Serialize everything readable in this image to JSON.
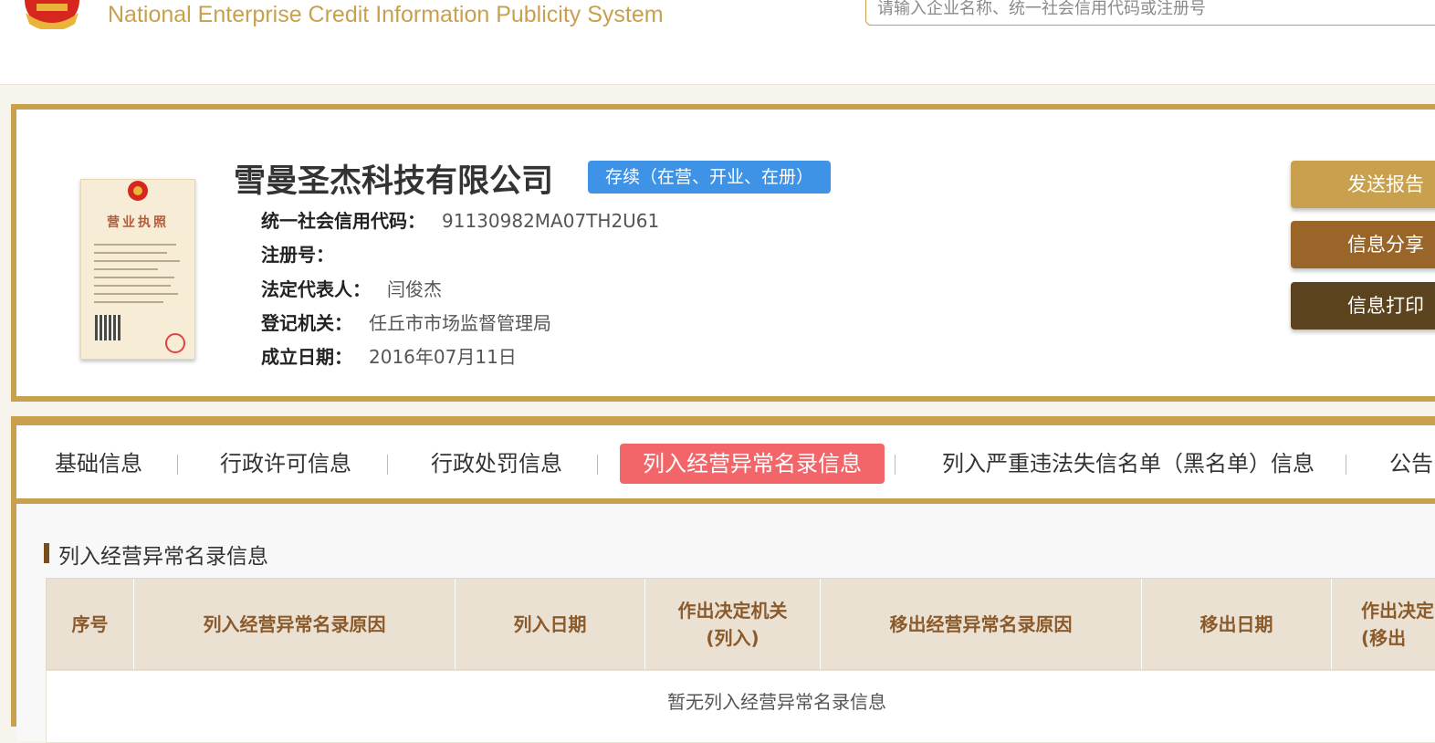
{
  "header": {
    "site_title": "National Enterprise Credit Information Publicity System",
    "search_placeholder": "请输入企业名称、统一社会信用代码或注册号"
  },
  "company": {
    "name": "雪曼圣杰科技有限公司",
    "status": "存续（在营、开业、在册）",
    "fields": {
      "credit_code_label": "统一社会信用代码：",
      "credit_code_value": "91130982MA07TH2U61",
      "reg_no_label": "注册号：",
      "reg_no_value": "",
      "legal_rep_label": "法定代表人：",
      "legal_rep_value": "闫俊杰",
      "authority_label": "登记机关：",
      "authority_value": "任丘市市场监督管理局",
      "founded_label": "成立日期：",
      "founded_value": "2016年07月11日"
    },
    "license_title": "营业执照"
  },
  "actions": {
    "send_report": "发送报告",
    "share_info": "信息分享",
    "print_info": "信息打印"
  },
  "tabs": [
    {
      "label": "基础信息",
      "active": false
    },
    {
      "label": "行政许可信息",
      "active": false
    },
    {
      "label": "行政处罚信息",
      "active": false
    },
    {
      "label": "列入经营异常名录信息",
      "active": true
    },
    {
      "label": "列入严重违法失信名单（黑名单）信息",
      "active": false
    },
    {
      "label": "公告",
      "active": false
    }
  ],
  "section": {
    "title": "列入经营异常名录信息",
    "columns": [
      "序号",
      "列入经营异常名录原因",
      "列入日期",
      "作出决定机关",
      "(列入)",
      "移出经营异常名录原因",
      "移出日期",
      "作出决定",
      "(移出"
    ],
    "empty_message": "暂无列入经营异常名录信息"
  },
  "colors": {
    "gold": "#c9a04d",
    "status_blue": "#3f93e6",
    "active_tab": "#f2666a",
    "share_brown": "#9a6528",
    "print_dark": "#5b441d"
  }
}
